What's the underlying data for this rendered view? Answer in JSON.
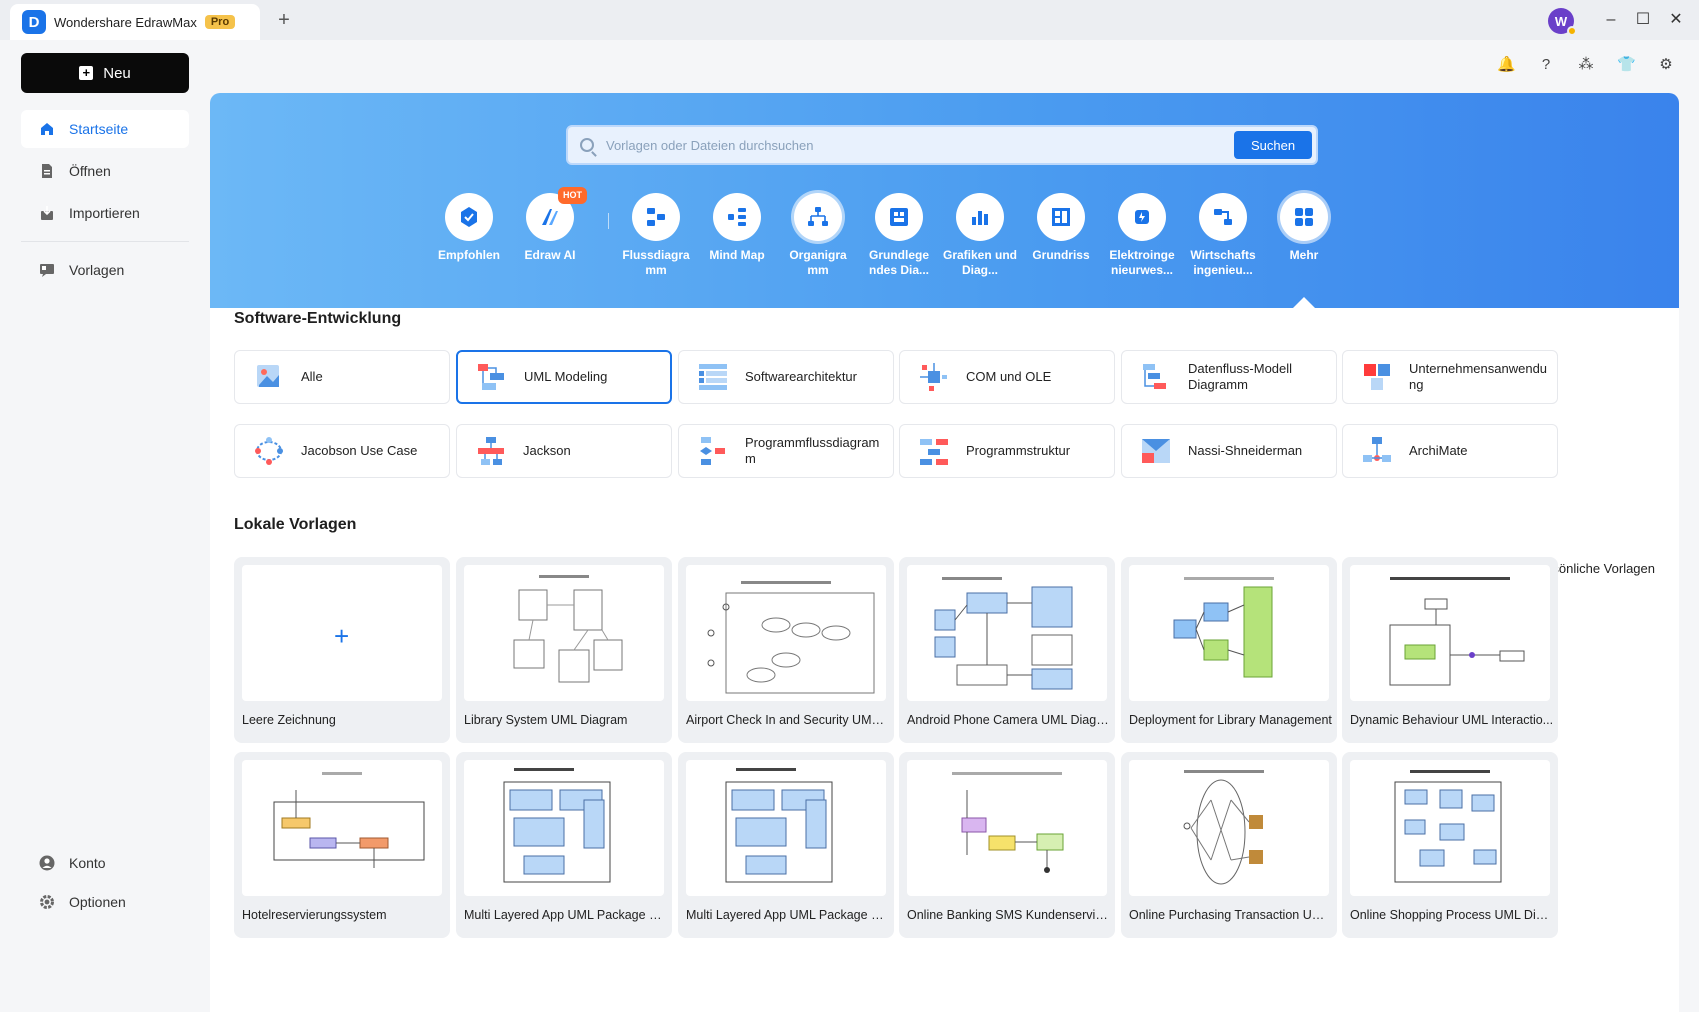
{
  "titlebar": {
    "app_name": "Wondershare EdrawMax",
    "badge": "Pro",
    "new_tab": "+",
    "avatar_letter": "W",
    "minimize": "–",
    "maximize": "☐",
    "close": "✕"
  },
  "sidebar": {
    "new_label": "Neu",
    "items": [
      {
        "label": "Startseite",
        "icon": "home-icon"
      },
      {
        "label": "Öffnen",
        "icon": "file-icon"
      },
      {
        "label": "Importieren",
        "icon": "import-icon"
      },
      {
        "label": "Vorlagen",
        "icon": "templates-icon"
      }
    ],
    "bottom": [
      {
        "label": "Konto",
        "icon": "user-icon"
      },
      {
        "label": "Optionen",
        "icon": "gear-icon"
      }
    ]
  },
  "search": {
    "placeholder": "Vorlagen oder Dateien durchsuchen",
    "button": "Suchen"
  },
  "categories": [
    {
      "label": "Empfohlen",
      "icon": "recommended-icon"
    },
    {
      "label": "Edraw AI",
      "icon": "ai-icon",
      "badge": "HOT"
    },
    {
      "label": "Flussdiagra mm",
      "icon": "flowchart-icon"
    },
    {
      "label": "Mind Map",
      "icon": "mindmap-icon"
    },
    {
      "label": "Organigra mm",
      "icon": "orgchart-icon"
    },
    {
      "label": "Grundlege ndes Dia...",
      "icon": "basic-diagram-icon"
    },
    {
      "label": "Grafiken und Diag...",
      "icon": "charts-icon"
    },
    {
      "label": "Grundriss",
      "icon": "floorplan-icon"
    },
    {
      "label": "Elektroinge nieurwes...",
      "icon": "electrical-icon"
    },
    {
      "label": "Wirtschafts ingenieu...",
      "icon": "industrial-icon"
    },
    {
      "label": "Mehr",
      "icon": "more-icon"
    }
  ],
  "software_section": {
    "title": "Software-Entwicklung",
    "items": [
      "Alle",
      "UML Modeling",
      "Softwarearchitektur",
      "COM und OLE",
      "Datenfluss-Modell Diagramm",
      "Unternehmensanwendu ng",
      "Jacobson Use Case",
      "Jackson",
      "Programmflussdiagram m",
      "Programmstruktur",
      "Nassi-Shneiderman",
      "ArchiMate"
    ],
    "selected_index": 1
  },
  "local_section": {
    "title": "Lokale Vorlagen",
    "personal": "Persönliche Vorlagen",
    "templates": [
      "Leere Zeichnung",
      "Library System UML Diagram",
      "Airport Check In and Security UML ...",
      "Android Phone Camera UML Diagram",
      "Deployment for Library Management",
      "Dynamic Behaviour UML Interactio...",
      "Hotelreservierungssystem",
      "Multi Layered App UML Package Di...",
      "Multi Layered App UML Package Di...",
      "Online Banking SMS Kundenservice ...",
      "Online Purchasing Transaction UML...",
      "Online Shopping Process UML Diag..."
    ],
    "blank_plus": "+"
  },
  "colors": {
    "accent": "#1a73e8",
    "hero_start": "#6cb8f6",
    "hero_end": "#3a83ec",
    "hot": "#ff6a2b"
  }
}
